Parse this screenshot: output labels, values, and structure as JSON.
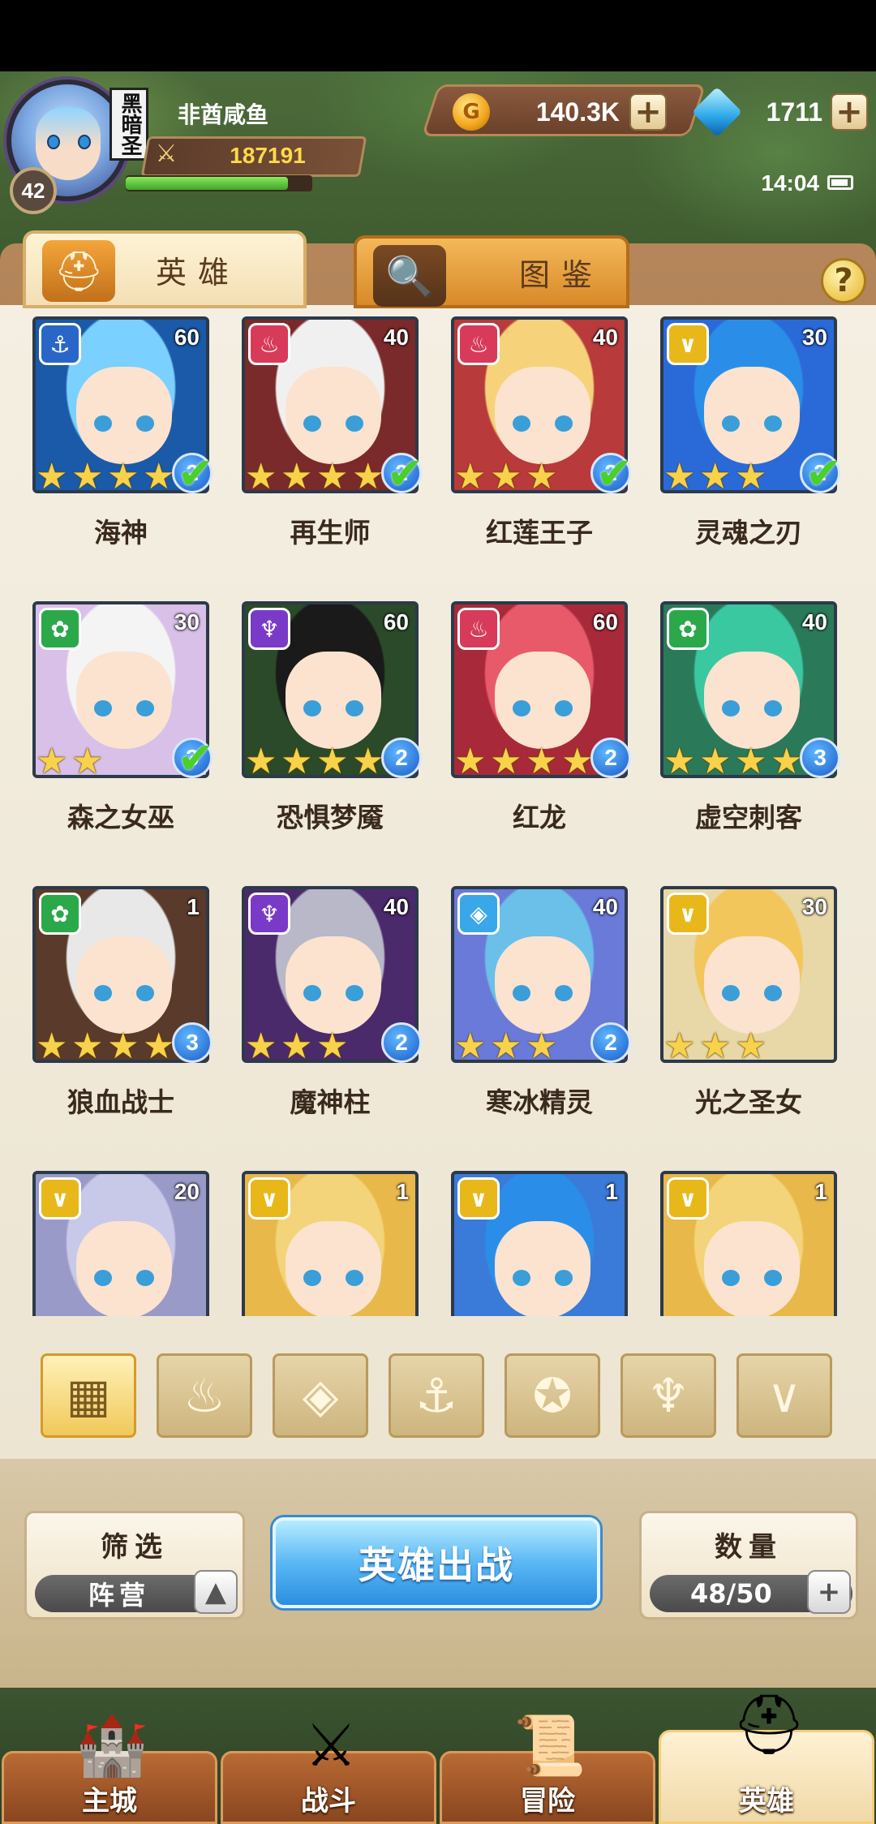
{
  "player": {
    "name": "非酋咸鱼",
    "guild_tag": "黑暗圣",
    "level": "42",
    "power": "187191",
    "xp_fraction": 0.87
  },
  "currency": {
    "gold": "140.3K",
    "gems": "1711",
    "gold_symbol": "G"
  },
  "status": {
    "time": "14:04"
  },
  "tabs": [
    {
      "label": "英雄",
      "active": true
    },
    {
      "label": "图鉴",
      "active": false
    }
  ],
  "help_label": "?",
  "heroes": [
    {
      "name": "海神",
      "level": "60",
      "stars": 4,
      "rank": "2",
      "element": "water",
      "checked": true
    },
    {
      "name": "再生师",
      "level": "40",
      "stars": 4,
      "rank": "2",
      "element": "fire",
      "checked": true
    },
    {
      "name": "红莲王子",
      "level": "40",
      "stars": 3,
      "rank": "2",
      "element": "fire",
      "checked": true
    },
    {
      "name": "灵魂之刃",
      "level": "30",
      "stars": 3,
      "rank": "2",
      "element": "light",
      "checked": true
    },
    {
      "name": "森之女巫",
      "level": "30",
      "stars": 2,
      "rank": "3",
      "element": "nature",
      "checked": true
    },
    {
      "name": "恐惧梦魇",
      "level": "60",
      "stars": 4,
      "rank": "2",
      "element": "dark",
      "checked": false
    },
    {
      "name": "红龙",
      "level": "60",
      "stars": 4,
      "rank": "2",
      "element": "fire",
      "checked": false
    },
    {
      "name": "虚空刺客",
      "level": "40",
      "stars": 4,
      "rank": "3",
      "element": "nature",
      "checked": false
    },
    {
      "name": "狼血战士",
      "level": "1",
      "stars": 4,
      "rank": "3",
      "element": "nature",
      "checked": false
    },
    {
      "name": "魔神柱",
      "level": "40",
      "stars": 3,
      "rank": "2",
      "element": "dark",
      "checked": false
    },
    {
      "name": "寒冰精灵",
      "level": "40",
      "stars": 3,
      "rank": "2",
      "element": "ice",
      "checked": false
    },
    {
      "name": "光之圣女",
      "level": "30",
      "stars": 3,
      "rank": "",
      "element": "light",
      "checked": false
    },
    {
      "name": "",
      "level": "20",
      "stars": 0,
      "rank": "",
      "element": "light",
      "checked": false
    },
    {
      "name": "",
      "level": "1",
      "stars": 0,
      "rank": "",
      "element": "light",
      "checked": false
    },
    {
      "name": "",
      "level": "1",
      "stars": 0,
      "rank": "",
      "element": "light",
      "checked": false
    },
    {
      "name": "",
      "level": "1",
      "stars": 0,
      "rank": "",
      "element": "light",
      "checked": false
    }
  ],
  "element_colors": {
    "water": "#2a66c8",
    "fire": "#d83a5a",
    "light": "#e8b81a",
    "nature": "#2aa84a",
    "dark": "#7a3ac8",
    "ice": "#3aa8e8"
  },
  "filters": [
    {
      "icon": "grid-icon",
      "selected": true
    },
    {
      "icon": "fire-element-icon",
      "selected": false
    },
    {
      "icon": "ice-element-icon",
      "selected": false
    },
    {
      "icon": "anchor-icon",
      "selected": false
    },
    {
      "icon": "wolf-icon",
      "selected": false
    },
    {
      "icon": "dark-horns-icon",
      "selected": false
    },
    {
      "icon": "light-chevron-icon",
      "selected": false
    }
  ],
  "bottom": {
    "filter_title": "筛选",
    "filter_value": "阵营",
    "deploy_label": "英雄出战",
    "count_title": "数量",
    "count_value": "48/50"
  },
  "nav": [
    {
      "label": "主城",
      "icon": "castle-icon",
      "active": false
    },
    {
      "label": "战斗",
      "icon": "crossed-swords-icon",
      "active": false
    },
    {
      "label": "冒险",
      "icon": "map-scroll-icon",
      "active": false
    },
    {
      "label": "英雄",
      "icon": "helmet-icon",
      "active": true
    }
  ]
}
